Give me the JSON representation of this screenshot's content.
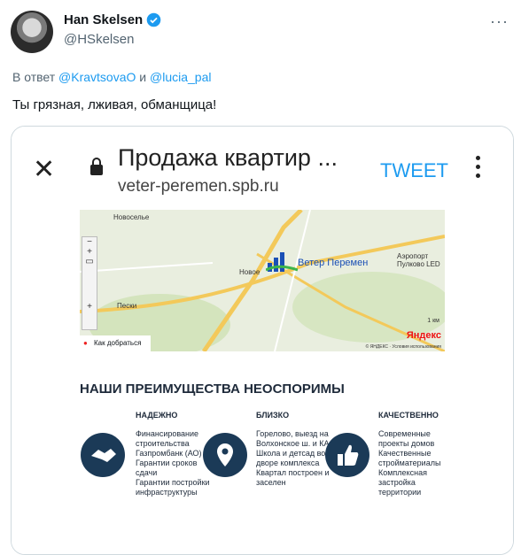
{
  "tweet": {
    "author_name": "Han Skelsen",
    "handle": "@HSkelsen",
    "reply_prefix": "В ответ",
    "reply_user1": "@KravtsovaO",
    "reply_and": "и",
    "reply_user2": "@lucia_pal",
    "text": "Ты грязная, лживая, обманщица!",
    "more_icon": "more-icon"
  },
  "card": {
    "page_title": "Продажа квартир ...",
    "url": "veter-peremen.spb.ru",
    "tweet_button": "TWEET",
    "map": {
      "labels": [
        "Новоселье",
        "Новое",
        "Пески",
        "Аэропорт Пулково LED"
      ],
      "route_link": "Как добраться",
      "logo_text": "Ветер Перемен",
      "scale": "1 км",
      "brand": "Яндекс",
      "copyright": "© ЯНДЕКС · Условия использования"
    },
    "heading": "НАШИ ПРЕИМУЩЕСТВА НЕОСПОРИМЫ",
    "columns": [
      {
        "title": "НАДЕЖНО",
        "text": "Финансирование строительства Газпромбанк (АО)\nГарантии сроков сдачи\nГарантии постройки инфраструктуры",
        "icon": "handshake-icon"
      },
      {
        "title": "БЛИЗКО",
        "text": "Горелово, выезд на Волхонское ш. и КАД\nШкола и детсад во дворе комплекса\nКвартал построен и заселен",
        "icon": "location-pin-icon"
      },
      {
        "title": "КАЧЕСТВЕННО",
        "text": "Современные проекты домов\nКачественные стройматериалы\nКомплексная застройка территории",
        "icon": "thumbs-up-icon"
      }
    ]
  }
}
